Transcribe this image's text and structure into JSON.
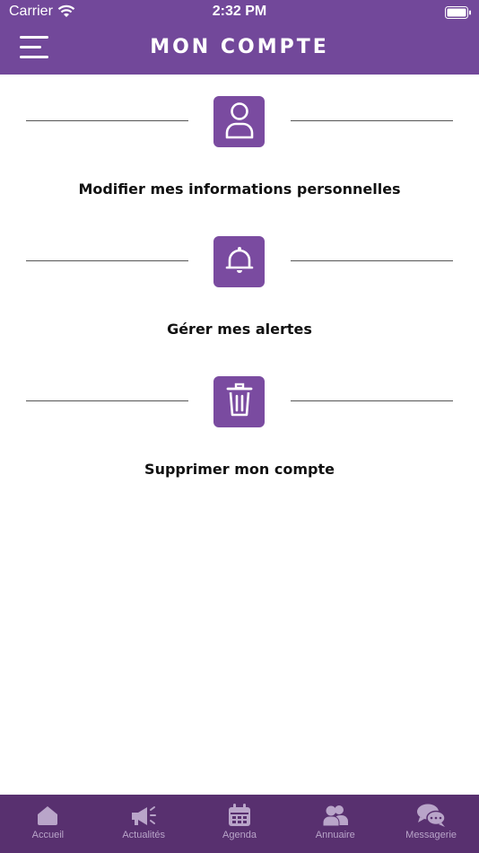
{
  "status_bar": {
    "carrier": "Carrier",
    "time": "2:32 PM"
  },
  "header": {
    "title": "MON COMPTE",
    "background": "#72489a"
  },
  "sections": [
    {
      "icon": "user-icon",
      "label": "Modifier mes informations personnelles"
    },
    {
      "icon": "bell-icon",
      "label": "Gérer mes alertes"
    },
    {
      "icon": "trash-icon",
      "label": "Supprimer mon compte"
    }
  ],
  "tabbar": {
    "background": "#58306f",
    "items": [
      {
        "icon": "home-icon",
        "label": "Accueil"
      },
      {
        "icon": "megaphone-icon",
        "label": "Actualités"
      },
      {
        "icon": "calendar-icon",
        "label": "Agenda"
      },
      {
        "icon": "users-icon",
        "label": "Annuaire"
      },
      {
        "icon": "chat-icon",
        "label": "Messagerie"
      }
    ]
  }
}
